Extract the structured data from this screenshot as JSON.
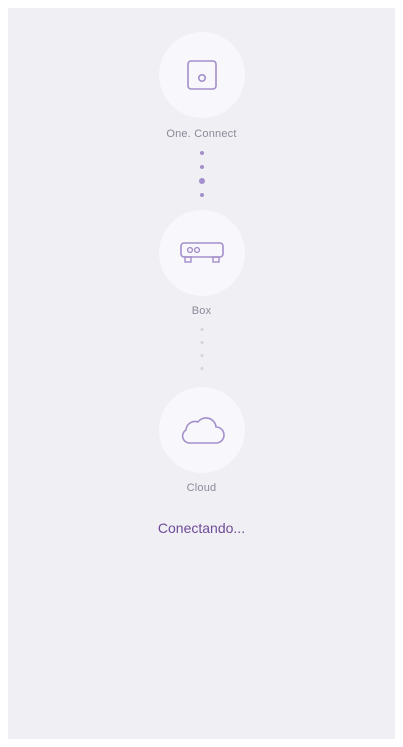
{
  "connection_flow": {
    "nodes": [
      {
        "label": "One. Connect",
        "icon": "one-connect-device-icon"
      },
      {
        "label": "Box",
        "icon": "box-device-icon"
      },
      {
        "label": "Cloud",
        "icon": "cloud-icon"
      }
    ],
    "status_text": "Conectando..."
  },
  "colors": {
    "background": "#efeff4",
    "node_fill": "#f8f7fb",
    "icon_stroke": "#a38fcb",
    "label": "#8d8a99",
    "status": "#6e4c98",
    "dot_active": "#a38fcb",
    "dot_inactive": "#d5d3dc"
  }
}
